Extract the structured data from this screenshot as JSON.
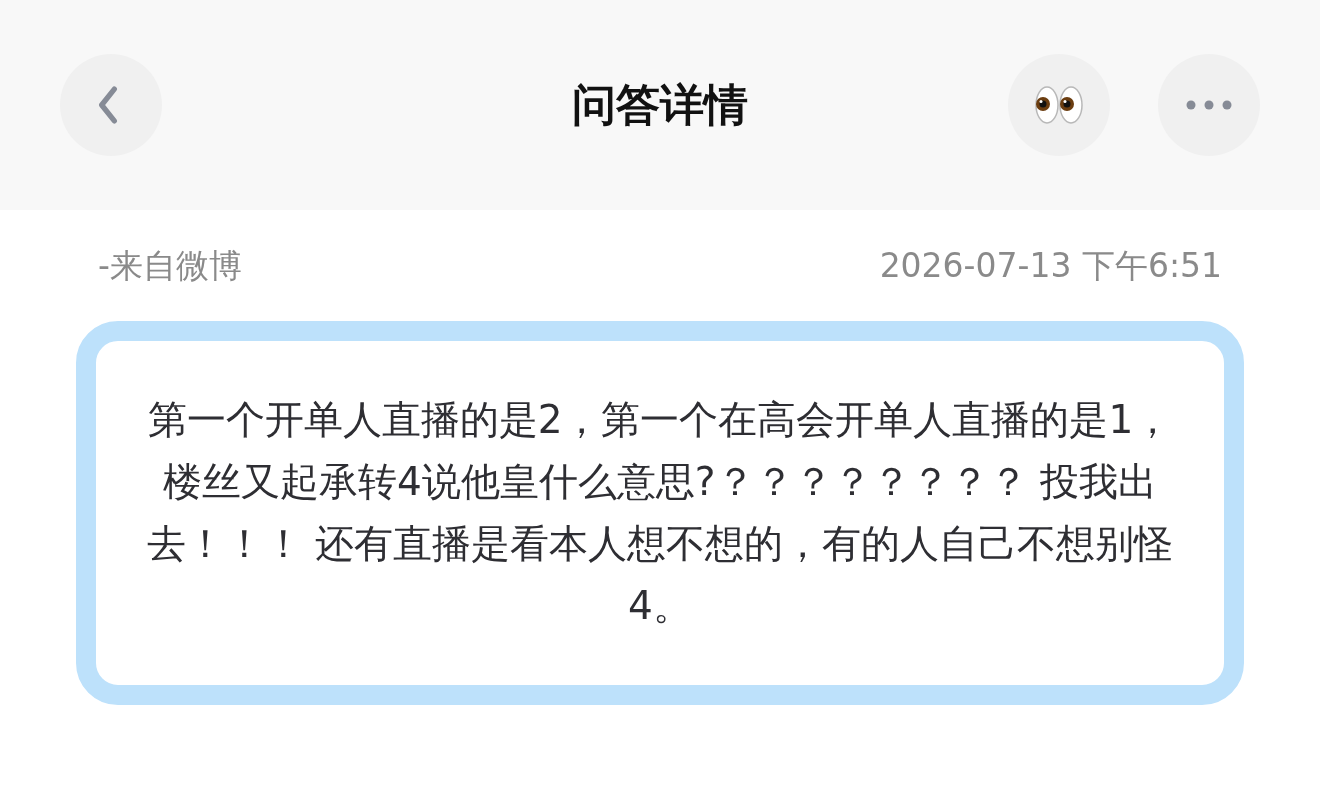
{
  "header": {
    "title": "问答详情"
  },
  "meta": {
    "source": "-来自微博",
    "time": "2026-07-13 下午6:51"
  },
  "question": {
    "text": "第一个开单人直播的是2，第一个在高会开单人直播的是1，楼丝又起承转4说他皇什么意思?？？？？？？？？ 投我出去！！！ 还有直播是看本人想不想的，有的人自己不想别怪4。"
  }
}
